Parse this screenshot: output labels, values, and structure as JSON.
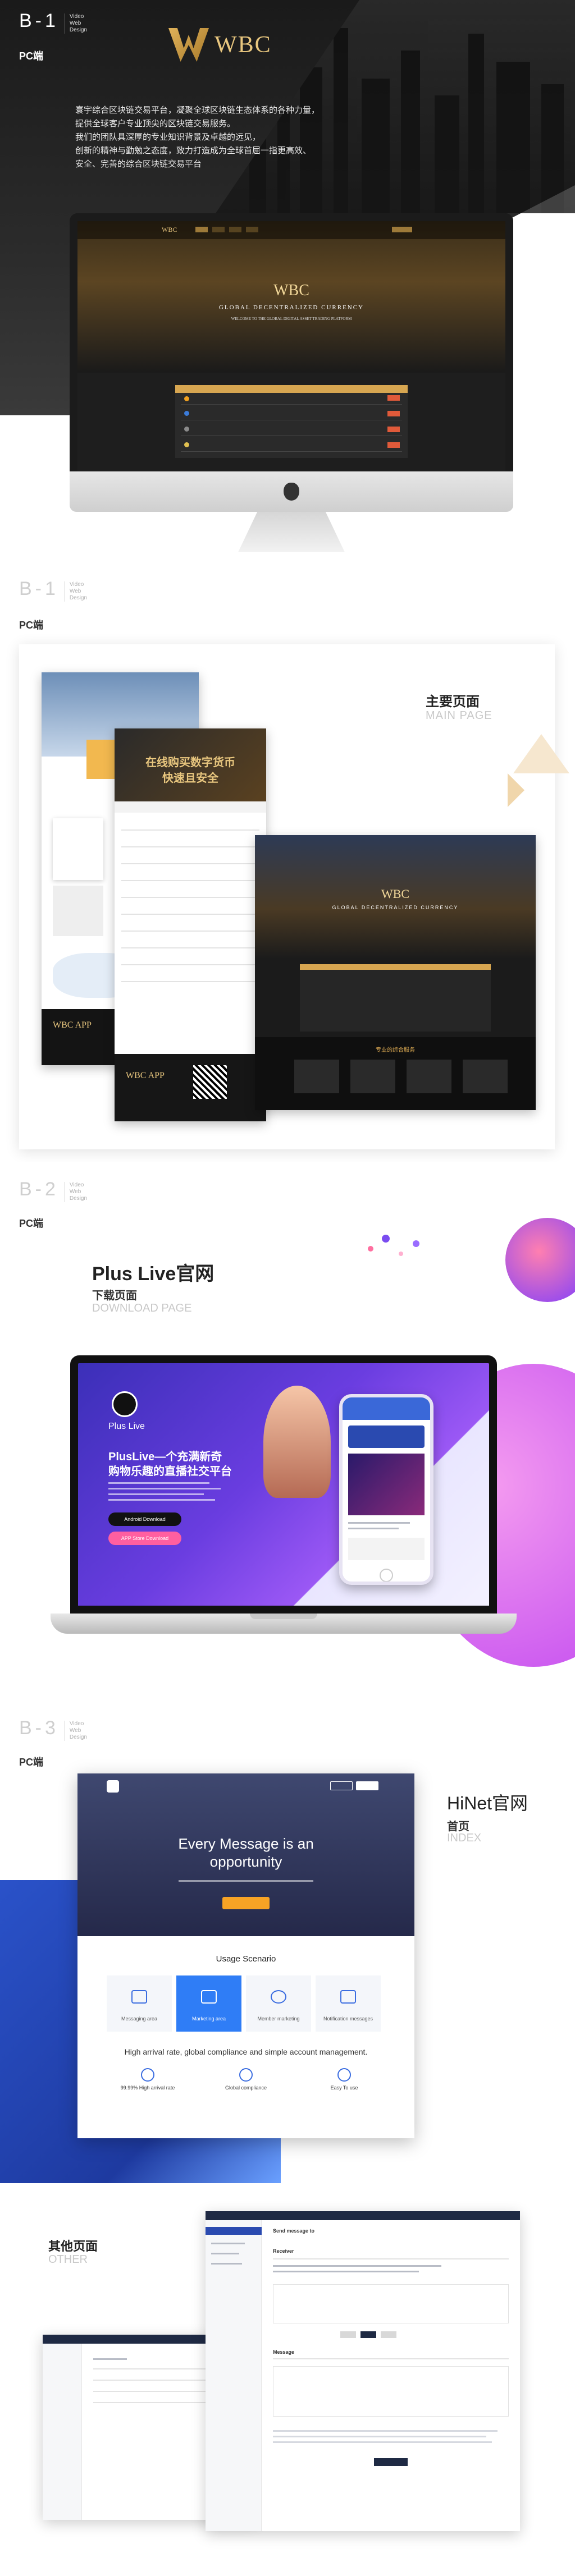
{
  "s1": {
    "code": "B-1",
    "meta": [
      "Video",
      "Web",
      "Design"
    ],
    "tag": "PC端",
    "brand": "WBC",
    "desc": [
      "寰宇综合区块链交易平台，凝聚全球区块链生态体系的各种力量，",
      "提供全球客户专业顶尖的区块链交易服务。",
      "我们的团队具深厚的专业知识背景及卓越的远见，",
      "创新的精神与勤勉之态度，致力打造成为全球首屈一指更高效、",
      "安全、完善的综合区块链交易平台"
    ],
    "screen": {
      "logo": "WBC",
      "big": "WBC",
      "subtitle": "GLOBAL DECENTRALIZED CURRENCY",
      "tagline": "WELCOME TO THE GLOBAL DIGITAL ASSET TRADING PLATFORM"
    }
  },
  "s2": {
    "code": "B-1",
    "meta": [
      "Video",
      "Web",
      "Design"
    ],
    "tag": "PC端",
    "title": "主要页面",
    "subtitle": "MAIN PAGE",
    "banner_line1": "在线购买数字货币",
    "banner_line2": "快速且安全",
    "screen_big": "WBC",
    "screen_subtitle": "GLOBAL DECENTRALIZED CURRENCY",
    "app_label": "WBC APP",
    "app_label2": "WBC APP",
    "strip_title": "专业的综合服务"
  },
  "s3": {
    "code": "B-2",
    "meta": [
      "Video",
      "Web",
      "Design"
    ],
    "tag": "PC端",
    "title": "Plus Live官网",
    "subtitle": "下载页面",
    "subtitle_en": "DOWNLOAD PAGE",
    "app_name": "Plus Live",
    "headline1": "PlusLive—个充满新奇",
    "headline2": "购物乐趣的直播社交平台",
    "btn_android": "Android Download",
    "btn_ios": "APP Store Download"
  },
  "s4": {
    "code": "B-3",
    "meta": [
      "Video",
      "Web",
      "Design"
    ],
    "tag": "PC端",
    "title": "HiNet官网",
    "subtitle": "首页",
    "subtitle_en": "INDEX",
    "hero1": "Every Message is an",
    "hero2": "opportunity",
    "scenario_title": "Usage Scenario",
    "tiles": [
      "Messaging area",
      "Marketing area",
      "Member marketing",
      "Notification messages"
    ],
    "line2": "High arrival rate, global compliance and simple account management.",
    "features": [
      "99.99% High arrival rate",
      "Global compliance",
      "Easy To use"
    ]
  },
  "s5": {
    "title": "其他页面",
    "subtitle": "OTHER",
    "win_title": "Send message to",
    "section_label": "Receiver",
    "message_label": "Message"
  },
  "colors": {
    "gold": "#d7a651",
    "dark": "#1e1e1e",
    "purple": "#6a3de0",
    "blue": "#2a52c9"
  }
}
